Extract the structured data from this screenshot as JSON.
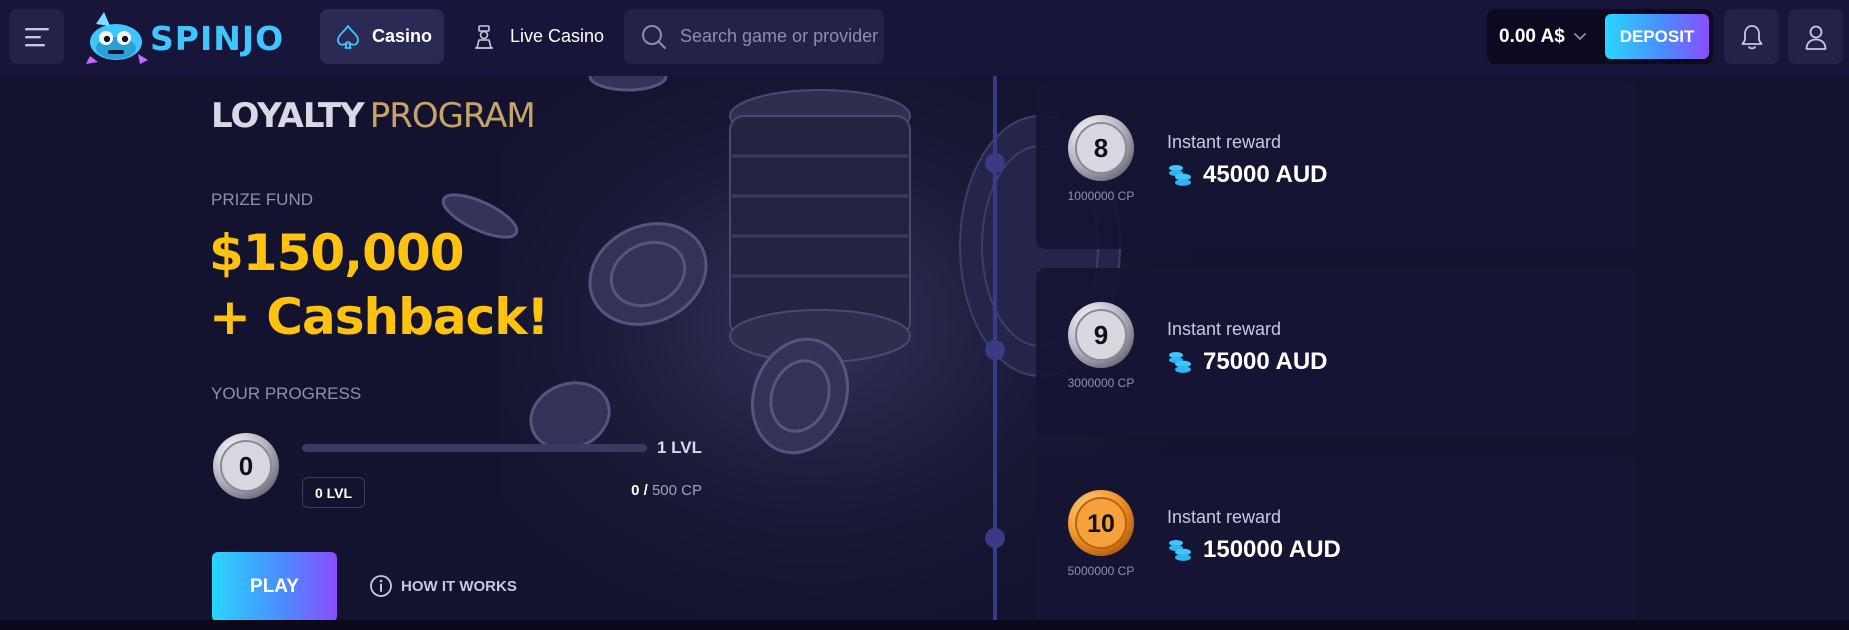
{
  "header": {
    "logo_text": "SPINJO",
    "nav": [
      {
        "label": "Casino",
        "icon": "spade-icon"
      },
      {
        "label": "Live Casino",
        "icon": "dealer-icon"
      }
    ],
    "search": {
      "placeholder": "Search game or provider",
      "value": ""
    },
    "balance": "0.00 A$",
    "deposit_label": "DEPOSIT"
  },
  "hero": {
    "title_bold": "LOYALTY",
    "title_light": "PROGRAM",
    "prize_label": "PRIZE FUND",
    "prize_amount": "$150,000",
    "prize_extra": "+ Cashback!",
    "progress_label": "YOUR PROGRESS",
    "current_badge": "0",
    "current_level": "0 LVL",
    "next_level": "1 LVL",
    "progress_fraction": 0,
    "points_current": "0 /",
    "points_target": "500 CP",
    "play_label": "PLAY",
    "how_label": "HOW IT WORKS"
  },
  "levels": [
    {
      "level": "8",
      "cp": "1000000 CP",
      "reward_label": "Instant reward",
      "reward": "45000 AUD",
      "tier": "silver"
    },
    {
      "level": "9",
      "cp": "3000000 CP",
      "reward_label": "Instant reward",
      "reward": "75000 AUD",
      "tier": "silver"
    },
    {
      "level": "10",
      "cp": "5000000 CP",
      "reward_label": "Instant reward",
      "reward": "150000 AUD",
      "tier": "gold"
    }
  ],
  "colors": {
    "accent": "#3fc6ff",
    "prize": "#ffc20e",
    "background": "#14132f",
    "timeline": "#3a3a85"
  }
}
